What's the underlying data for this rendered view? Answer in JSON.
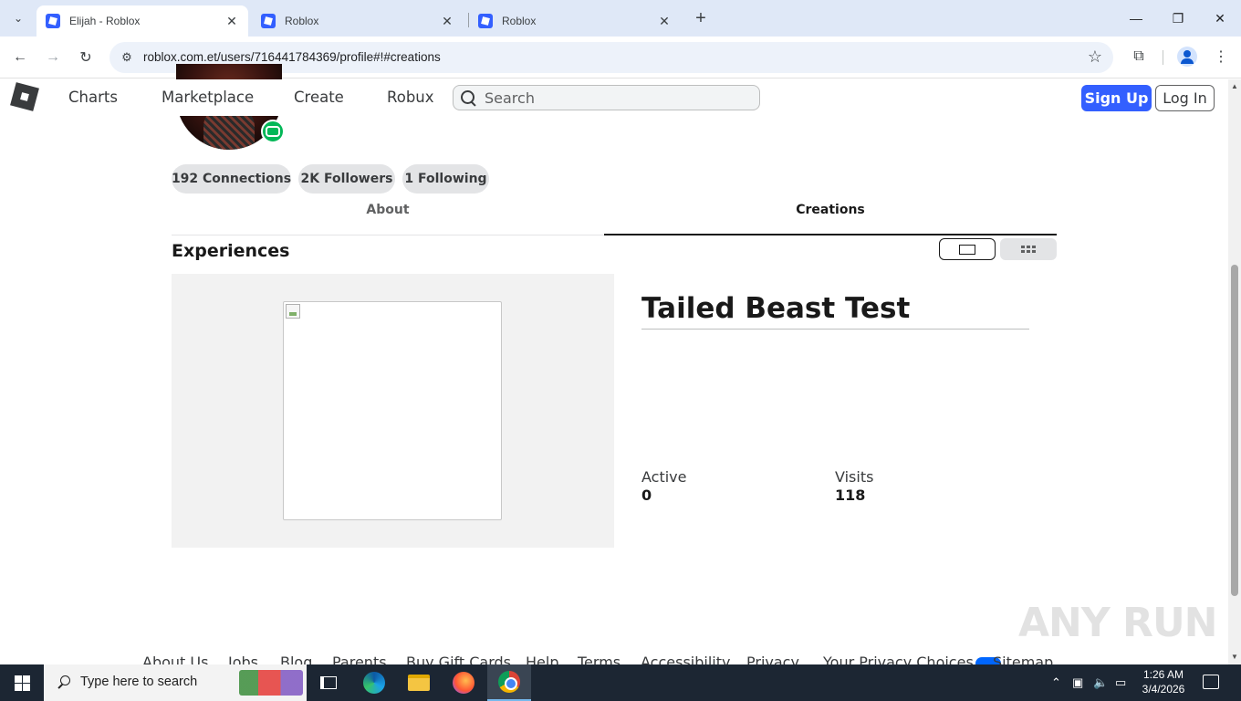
{
  "browser": {
    "tabs": [
      {
        "title": "Elijah - Roblox",
        "active": true
      },
      {
        "title": "Roblox",
        "active": false
      },
      {
        "title": "Roblox",
        "active": false
      }
    ],
    "url": "roblox.com.et/users/716441784369/profile#!#creations",
    "new_tab_label": "+",
    "minimize_label": "—",
    "restore_label": "❐",
    "close_label": "✕"
  },
  "roblox_header": {
    "nav": [
      "Charts",
      "Marketplace",
      "Create",
      "Robux"
    ],
    "search_placeholder": "Search",
    "signup_label": "Sign Up",
    "login_label": "Log In"
  },
  "profile": {
    "connections": "192 Connections",
    "followers": "2K Followers",
    "following": "1 Following",
    "tabs": {
      "about": "About",
      "creations": "Creations"
    },
    "section_title": "Experiences"
  },
  "experience": {
    "title": "Tailed Beast Test",
    "active_label": "Active",
    "active_value": "0",
    "visits_label": "Visits",
    "visits_value": "118"
  },
  "footer": {
    "links": [
      "About Us",
      "Jobs",
      "Blog",
      "Parents",
      "Buy Gift Cards",
      "Help",
      "Terms",
      "Accessibility",
      "Privacy",
      "Your Privacy Choices",
      "Sitemap"
    ]
  },
  "watermark": "ANY RUN",
  "taskbar": {
    "search_placeholder": "Type here to search",
    "time": "1:26 AM",
    "date": "3/4/2026"
  },
  "colors": {
    "roblox_blue": "#335fff",
    "taskbar_bg": "#1c2633",
    "tab_strip": "#dfe8f7"
  }
}
